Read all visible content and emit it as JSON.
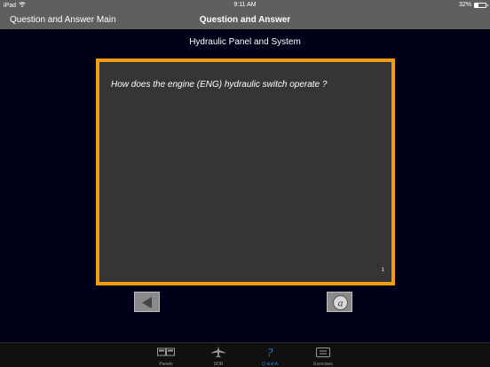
{
  "status_bar": {
    "device": "iPad",
    "time": "9:11 AM",
    "battery_text": "32%",
    "battery_level": 0.32
  },
  "nav": {
    "back_label": "Question and Answer Main",
    "title": "Question and Answer"
  },
  "section_title": "Hydraulic Panel and System",
  "question": {
    "text": "How does the engine (ENG) hydraulic switch operate ?",
    "page_number": "1"
  },
  "buttons": {
    "prev_icon": "left-arrow-icon",
    "answer_icon": "answer-a-icon"
  },
  "tabs": [
    {
      "label": "Panels",
      "icon": "panels-icon",
      "active": false
    },
    {
      "label": "SOR",
      "icon": "airplane-icon",
      "active": false
    },
    {
      "label": "Q and A",
      "icon": "question-icon",
      "active": true
    },
    {
      "label": "Exercises",
      "icon": "exercises-icon",
      "active": false
    }
  ],
  "colors": {
    "accent_border": "#f39c12",
    "active_tab": "#2f7de1",
    "background": "#000018",
    "bar": "#5f5f5f"
  }
}
